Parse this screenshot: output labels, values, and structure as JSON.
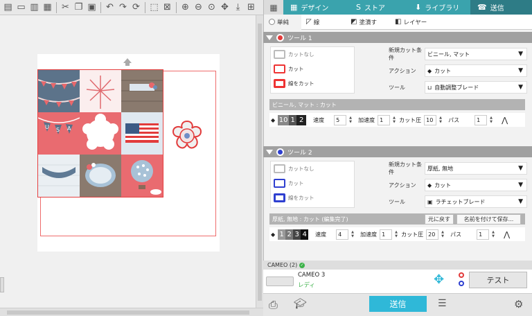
{
  "toolbar": {
    "icons": [
      "save-icon",
      "open-icon",
      "save-as-icon",
      "print-icon",
      "cut-icon",
      "copy-icon",
      "paste-icon",
      "undo-icon",
      "redo-icon",
      "rotate-icon",
      "select-all-icon",
      "deselect-icon",
      "zoom-in-icon",
      "zoom-out-icon",
      "zoom-selected-icon",
      "move-icon",
      "zoom-fit-icon",
      "add-icon"
    ]
  },
  "nav": {
    "tabs": [
      {
        "label": "デザイン",
        "icon": "grid-icon"
      },
      {
        "label": "ストア",
        "icon": "store-icon"
      },
      {
        "label": "ライブラリ",
        "icon": "library-icon"
      },
      {
        "label": "送信",
        "icon": "send-icon"
      }
    ],
    "active_index": 3
  },
  "subtabs": [
    {
      "label": "単純"
    },
    {
      "label": "線"
    },
    {
      "label": "塗潰す"
    },
    {
      "label": "レイヤー"
    }
  ],
  "tool1": {
    "title": "ツール 1",
    "color": "#e23b3b",
    "options": [
      "カットなし",
      "カット",
      "線をカット"
    ],
    "cut_condition_label": "新規カット条件",
    "cut_condition_value": "ビニール, マット",
    "action_label": "アクション",
    "action_value": "カット",
    "tool_label": "ツール",
    "tool_value": "自動調整ブレード",
    "summary": "ビニール, マット : カット",
    "blade": [
      "10",
      "1",
      "2"
    ],
    "speed_label": "速度",
    "speed": "5",
    "accel_label": "加速度",
    "accel": "1",
    "force_label": "カット圧",
    "force": "10",
    "pass_label": "パス",
    "pass": "1"
  },
  "tool2": {
    "title": "ツール 2",
    "color": "#2e3fd0",
    "options": [
      "カットなし",
      "カット",
      "線をカット"
    ],
    "cut_condition_label": "新規カット条件",
    "cut_condition_value": "厚紙, 無地",
    "action_label": "アクション",
    "action_value": "カット",
    "tool_label": "ツール",
    "tool_value": "ラチェットブレード",
    "summary": "厚紙, 無地 : カット (編集完了)",
    "undo_button": "元に戻す",
    "save_as_button": "名前を付けて保存...",
    "blade": [
      "1",
      "2",
      "3",
      "4"
    ],
    "speed_label": "速度",
    "speed": "4",
    "accel_label": "加速度",
    "accel": "1",
    "force_label": "カット圧",
    "force": "20",
    "pass_label": "パス",
    "pass": "1"
  },
  "cameo": {
    "header": "CAMEO (2)",
    "name": "CAMEO 3",
    "status": "レディ",
    "test_button": "テスト"
  },
  "bottom": {
    "send_button": "送信"
  },
  "colors": {
    "teal": "#3aa3ad",
    "send_blue": "#2fb8d8",
    "ready_green": "#3db24a"
  }
}
